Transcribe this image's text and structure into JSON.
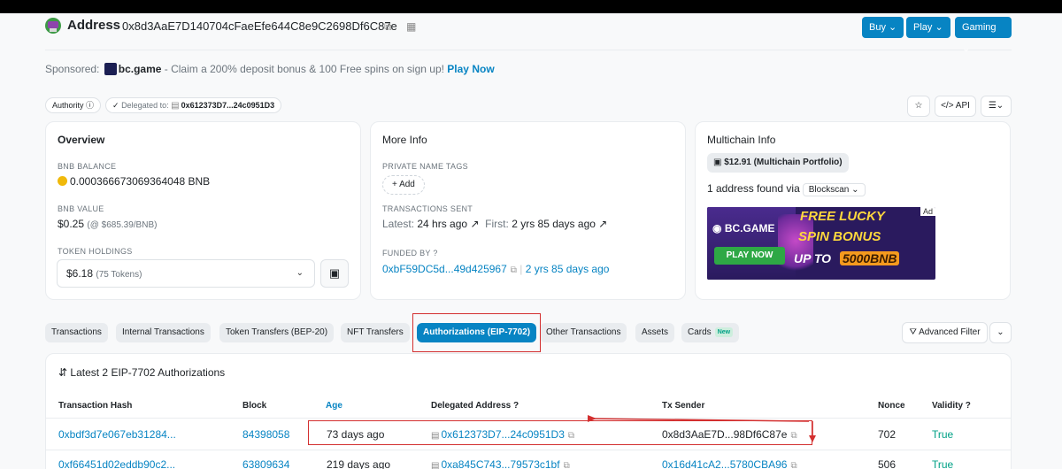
{
  "header": {
    "title": "Address",
    "address": "0x8d3AaE7D140704cFaeEfe644C8e9C2698Df6C87e",
    "buttons": [
      "Buy",
      "Play",
      "Gaming"
    ]
  },
  "sponsor": {
    "prefix": "Sponsored:",
    "brand": "bc.game",
    "text": "- Claim a 200% deposit bonus & 100 Free spins on sign up!",
    "cta": "Play Now"
  },
  "tags": {
    "authority": "Authority",
    "delegated_label": "Delegated to:",
    "delegated_addr": "0x612373D7...24c0951D3"
  },
  "toolbar": {
    "api": "API"
  },
  "overview": {
    "title": "Overview",
    "bnb_balance_label": "BNB BALANCE",
    "bnb_balance": "0.000366673069364048 BNB",
    "bnb_value_label": "BNB VALUE",
    "bnb_value": "$0.25",
    "bnb_price": "(@ $685.39/BNB)",
    "token_holdings_label": "TOKEN HOLDINGS",
    "token_value": "$6.18",
    "token_count": "(75 Tokens)"
  },
  "more_info": {
    "title": "More Info",
    "private_tags_label": "PRIVATE NAME TAGS",
    "add_label": "+ Add",
    "tx_sent_label": "TRANSACTIONS SENT",
    "latest_label": "Latest:",
    "latest_value": "24 hrs ago",
    "first_label": "First:",
    "first_value": "2 yrs 85 days ago",
    "funded_by_label": "FUNDED BY",
    "funded_addr": "0xbF59DC5d...49d425967",
    "funded_age": "2 yrs 85 days ago"
  },
  "multichain": {
    "title": "Multichain Info",
    "portfolio": "$12.91 (Multichain Portfolio)",
    "found_text": "1 address found via",
    "blockscan": "Blockscan"
  },
  "ad": {
    "brand": "BC.GAME",
    "play": "PLAY NOW",
    "line1": "FREE LUCKY",
    "line2": "SPIN BONUS",
    "upto": "UP TO",
    "amount": "5000BNB",
    "tag": "Ad"
  },
  "tabs": [
    "Transactions",
    "Internal Transactions",
    "Token Transfers (BEP-20)",
    "NFT Transfers",
    "Authorizations (EIP-7702)",
    "Other Transactions",
    "Assets",
    "Cards"
  ],
  "cards_badge": "New",
  "advanced_filter": "Advanced Filter",
  "table": {
    "title": "Latest 2 EIP-7702 Authorizations",
    "columns": [
      "Transaction Hash",
      "Block",
      "Age",
      "Delegated Address",
      "Tx Sender",
      "Nonce",
      "Validity"
    ],
    "rows": [
      {
        "hash": "0xbdf3d7e067eb31284...",
        "block": "84398058",
        "age": "73 days ago",
        "delegated": "0x612373D7...24c0951D3",
        "sender": "0x8d3AaE7D...98Df6C87e",
        "nonce": "702",
        "validity": "True"
      },
      {
        "hash": "0xf66451d02eddb90c2...",
        "block": "63809634",
        "age": "219 days ago",
        "delegated": "0xa845C743...79573c1bf",
        "sender": "0x16d41cA2...5780CBA96",
        "nonce": "506",
        "validity": "True"
      }
    ]
  },
  "colors": {
    "accent": "#0784c3",
    "annotation": "#d32f2f"
  }
}
